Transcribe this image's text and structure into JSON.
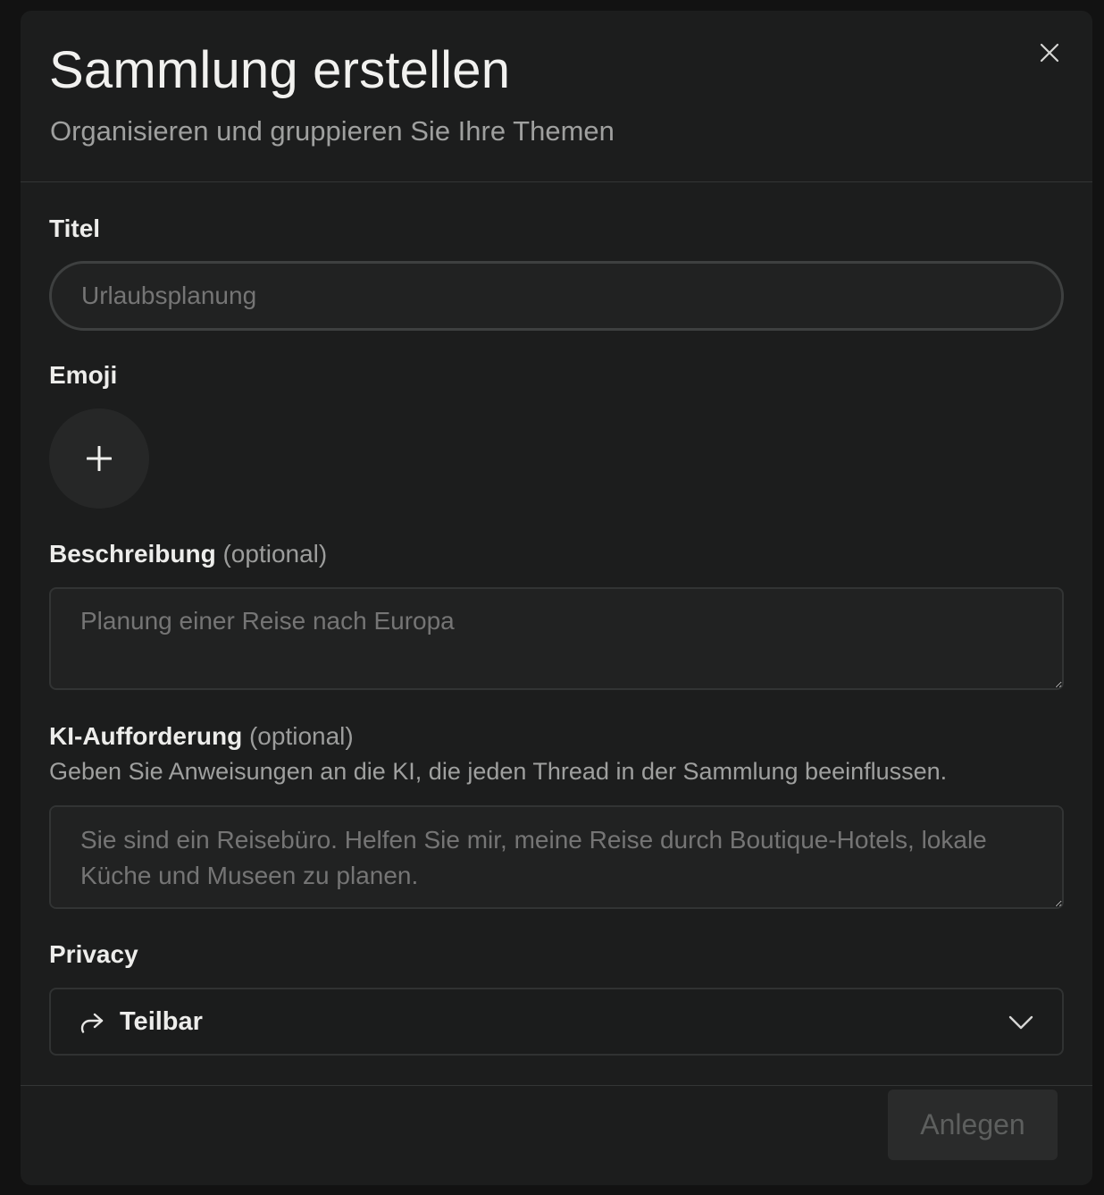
{
  "dialog": {
    "title": "Sammlung erstellen",
    "subtitle": "Organisieren und gruppieren Sie Ihre Themen",
    "close_icon": "close-icon"
  },
  "form": {
    "title_field": {
      "label": "Titel",
      "placeholder": "Urlaubsplanung",
      "value": ""
    },
    "emoji_field": {
      "label": "Emoji",
      "button_icon": "plus-icon"
    },
    "description_field": {
      "label": "Beschreibung",
      "optional_hint": "(optional)",
      "placeholder": "Planung einer Reise nach Europa",
      "value": ""
    },
    "ai_prompt_field": {
      "label": "KI-Aufforderung",
      "optional_hint": "(optional)",
      "helper": "Geben Sie Anweisungen an die KI, die jeden Thread in der Sammlung beeinflussen.",
      "placeholder": "Sie sind ein Reisebüro. Helfen Sie mir, meine Reise durch Boutique-Hotels, lokale Küche und Museen zu planen.",
      "value": ""
    },
    "privacy_field": {
      "label": "Privacy",
      "selected": "Teilbar",
      "icon": "share-arrow-icon",
      "dropdown_icon": "chevron-down-icon"
    }
  },
  "footer": {
    "submit_label": "Anlegen",
    "submit_disabled": true
  },
  "colors": {
    "backdrop": "#121212",
    "dialog_bg": "#1c1d1d",
    "input_bg": "#212222",
    "border": "#333535",
    "text_primary": "#ededeb",
    "text_muted": "#9fa09f",
    "button_disabled_bg": "#2a2b2b",
    "button_disabled_text": "#5d5f5e"
  }
}
